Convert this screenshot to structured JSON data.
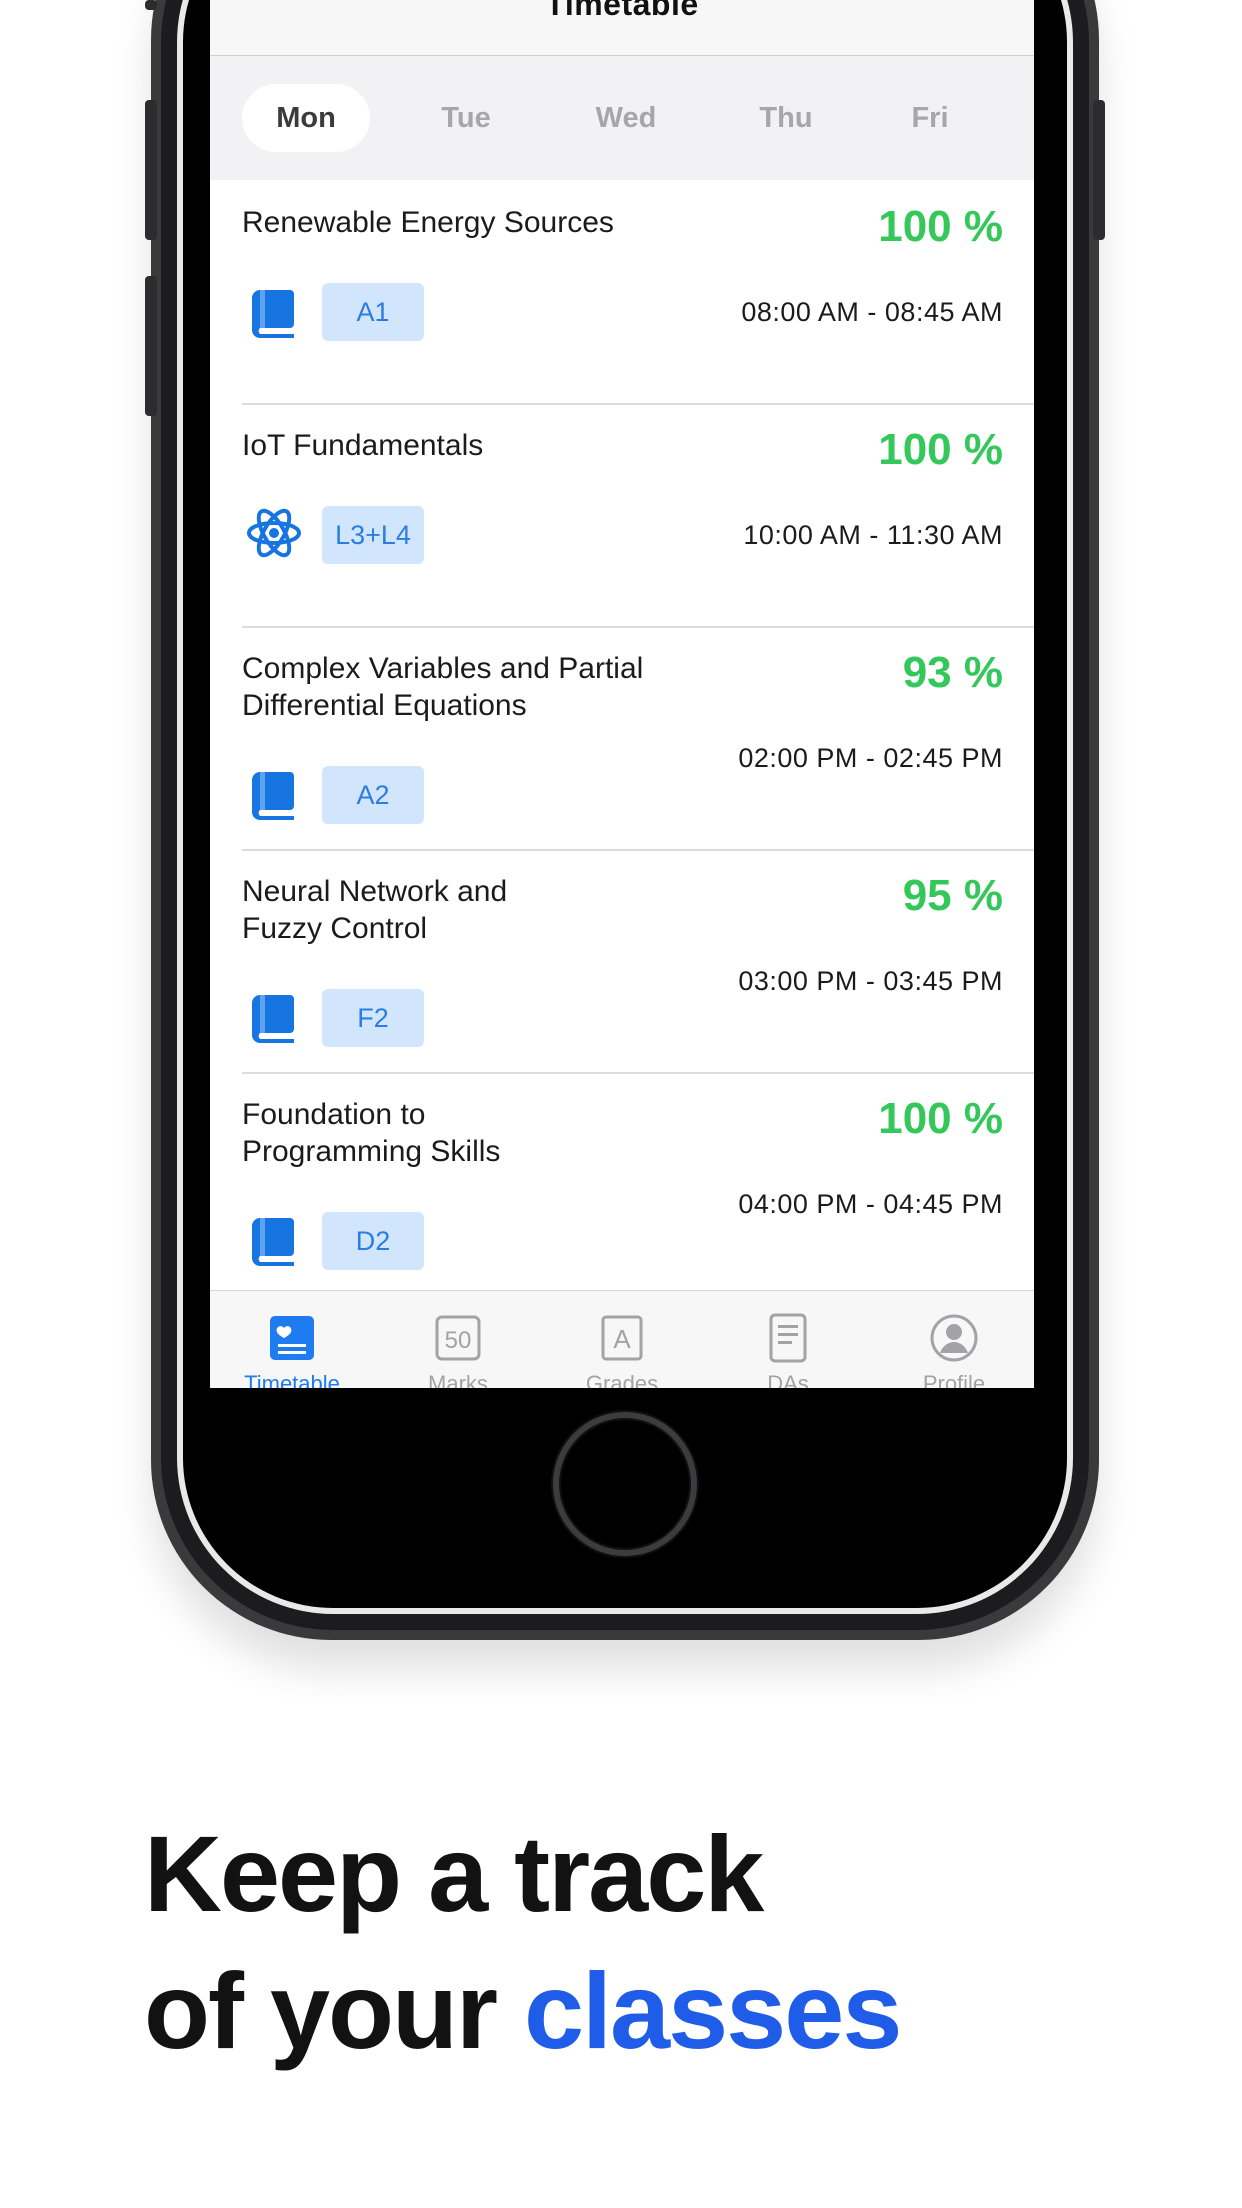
{
  "screen": {
    "title": "Timetable",
    "days": [
      "Mon",
      "Tue",
      "Wed",
      "Thu",
      "Fri"
    ],
    "selected_day": "Mon",
    "classes": [
      {
        "course": "Renewable Energy Sources",
        "slot": "A1",
        "type_icon": "book-icon",
        "attendance": "100 %",
        "time": "08:00 AM - 08:45 AM"
      },
      {
        "course": "IoT Fundamentals",
        "slot": "L3+L4",
        "type_icon": "atom-icon",
        "attendance": "100 %",
        "time": "10:00 AM - 11:30 AM"
      },
      {
        "course": "Complex Variables and Partial Differential Equations",
        "slot": "A2",
        "type_icon": "book-icon",
        "attendance": "93 %",
        "time": "02:00 PM - 02:45 PM"
      },
      {
        "course": "Neural Network and Fuzzy Control",
        "slot": "F2",
        "type_icon": "book-icon",
        "attendance": "95 %",
        "time": "03:00 PM - 03:45 PM"
      },
      {
        "course": "Foundation to Programming Skills",
        "slot": "D2",
        "type_icon": "book-icon",
        "attendance": "100 %",
        "time": "04:00 PM - 04:45 PM"
      }
    ],
    "tabs": [
      {
        "label": "Timetable",
        "icon": "calendar-heart-icon",
        "active": true
      },
      {
        "label": "Marks",
        "icon": "marks-50-icon",
        "icon_text": "50",
        "active": false
      },
      {
        "label": "Grades",
        "icon": "grade-a-icon",
        "icon_text": "A",
        "active": false
      },
      {
        "label": "DAs",
        "icon": "document-icon",
        "active": false
      },
      {
        "label": "Profile",
        "icon": "profile-icon",
        "active": false
      }
    ]
  },
  "headline": {
    "line1": "Keep a track",
    "line2_prefix": "of your ",
    "line2_accent": "classes"
  },
  "colors": {
    "attendance_green": "#34c759",
    "accent_blue": "#1f5de8",
    "tab_active": "#1e7cf0",
    "slot_bg": "#d1e6fd"
  }
}
